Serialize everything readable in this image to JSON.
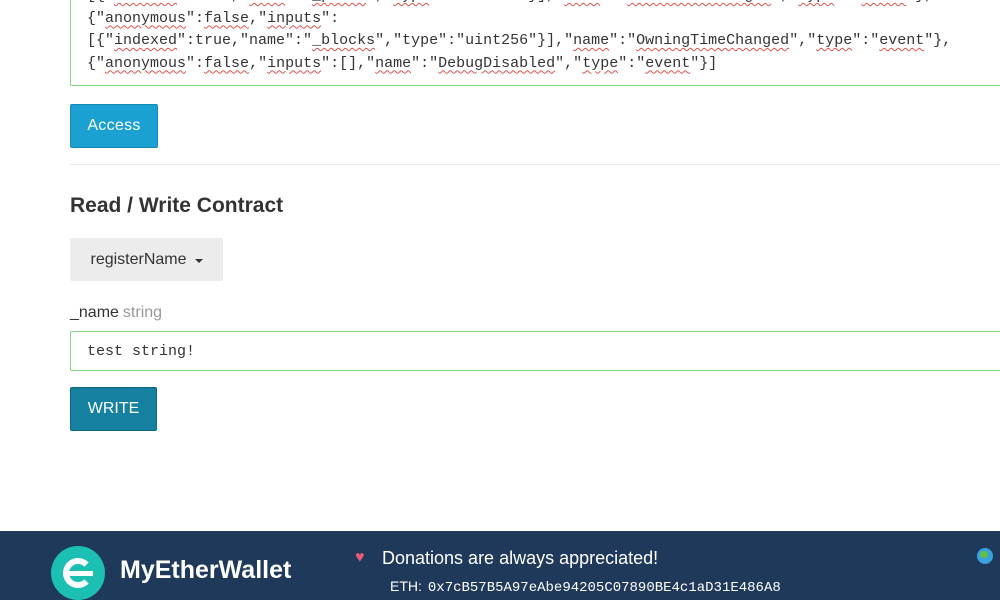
{
  "abi": {
    "lines": [
      [
        {
          "t": "[{\"",
          "s": false
        },
        {
          "t": "indexed",
          "s": true
        },
        {
          "t": "\":true,\"",
          "s": false
        },
        {
          "t": "name",
          "s": true
        },
        {
          "t": "\":\"",
          "s": false
        },
        {
          "t": "_price",
          "s": true
        },
        {
          "t": "\",\"",
          "s": false
        },
        {
          "t": "type",
          "s": true
        },
        {
          "t": "\":\"uint256\"}],\"",
          "s": false
        },
        {
          "t": "name",
          "s": true
        },
        {
          "t": "\":\"",
          "s": false
        },
        {
          "t": "NamePriceChanged",
          "s": true
        },
        {
          "t": "\",\"",
          "s": false
        },
        {
          "t": "type",
          "s": true
        },
        {
          "t": "\":\"",
          "s": false
        },
        {
          "t": "event",
          "s": true
        },
        {
          "t": "\"},",
          "s": false
        }
      ],
      [
        {
          "t": "{\"",
          "s": false
        },
        {
          "t": "anonymous",
          "s": true
        },
        {
          "t": "\":",
          "s": false
        },
        {
          "t": "false",
          "s": true
        },
        {
          "t": ",\"",
          "s": false
        },
        {
          "t": "inputs",
          "s": true
        },
        {
          "t": "\":",
          "s": false
        }
      ],
      [
        {
          "t": "[{\"",
          "s": false
        },
        {
          "t": "indexed",
          "s": true
        },
        {
          "t": "\":true,\"name\":\"",
          "s": false
        },
        {
          "t": "_blocks",
          "s": true
        },
        {
          "t": "\",\"type\":\"uint256\"}],\"",
          "s": false
        },
        {
          "t": "name",
          "s": true
        },
        {
          "t": "\":\"",
          "s": false
        },
        {
          "t": "OwningTimeChanged",
          "s": true
        },
        {
          "t": "\",\"",
          "s": false
        },
        {
          "t": "type",
          "s": true
        },
        {
          "t": "\":\"",
          "s": false
        },
        {
          "t": "event",
          "s": true
        },
        {
          "t": "\"},",
          "s": false
        }
      ],
      [
        {
          "t": "{\"",
          "s": false
        },
        {
          "t": "anonymous",
          "s": true
        },
        {
          "t": "\":",
          "s": false
        },
        {
          "t": "false",
          "s": true
        },
        {
          "t": ",\"",
          "s": false
        },
        {
          "t": "inputs",
          "s": true
        },
        {
          "t": "\":[],\"",
          "s": false
        },
        {
          "t": "name",
          "s": true
        },
        {
          "t": "\":\"",
          "s": false
        },
        {
          "t": "DebugDisabled",
          "s": true
        },
        {
          "t": "\",\"",
          "s": false
        },
        {
          "t": "type",
          "s": true
        },
        {
          "t": "\":\"",
          "s": false
        },
        {
          "t": "event",
          "s": true
        },
        {
          "t": "\"}]",
          "s": false
        }
      ]
    ]
  },
  "access_button": "Access",
  "section_title": "Read / Write Contract",
  "function_select": {
    "selected": "registerName"
  },
  "param": {
    "name": "_name",
    "type": "string",
    "value": "test string!"
  },
  "write_button": "WRITE",
  "footer": {
    "brand": "MyEtherWallet",
    "heart_icon": "heart-icon",
    "donations_text": "Donations are always appreciated!",
    "eth_label": "ETH:",
    "eth_address": "0x7cB57B5A97eAbe94205C07890BE4c1aD31E486A8",
    "globe_icon": "globe-icon"
  },
  "colors": {
    "access_button": "#1ba1d1",
    "write_button": "#15809f",
    "footer_bg": "#1e3959",
    "valid_border": "#7fd37f"
  }
}
